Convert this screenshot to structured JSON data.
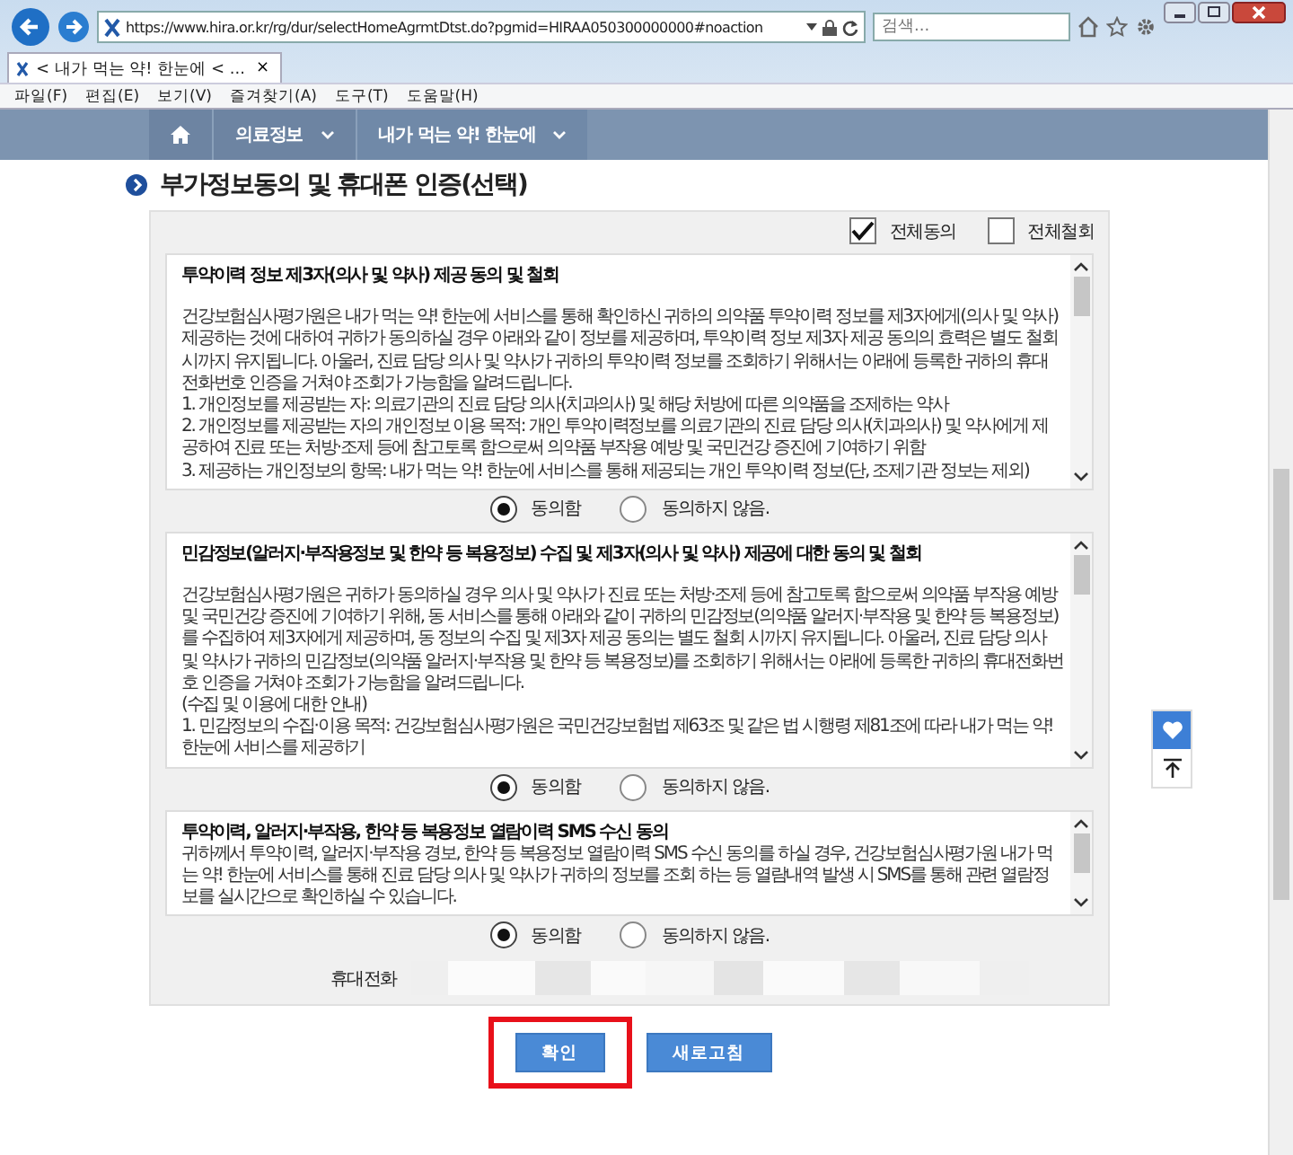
{
  "browser": {
    "url": "https://www.hira.or.kr/rg/dur/selectHomeAgrmtDtst.do?pgmid=HIRAA050300000000#noaction",
    "search_placeholder": "검색...",
    "tab": {
      "title": "< 내가 먹는 약! 한눈에 < ...",
      "close": "×"
    },
    "menu": [
      "파일(F)",
      "편집(E)",
      "보기(V)",
      "즐겨찾기(A)",
      "도구(T)",
      "도움말(H)"
    ]
  },
  "nav": {
    "items": [
      "의료정보",
      "내가 먹는 약! 한눈에"
    ]
  },
  "heading": "부가정보동의 및 휴대폰 인증(선택)",
  "bulk": [
    {
      "label": "전체동의",
      "checked": true
    },
    {
      "label": "전체철회",
      "checked": false
    }
  ],
  "sections": [
    {
      "title": "투약이력 정보 제3자(의사 및 약사) 제공 동의 및 철회",
      "gap": true,
      "paragraphs": [
        "건강보험심사평가원은 내가 먹는 약! 한눈에 서비스를 통해 확인하신 귀하의 의약품 투약이력 정보를 제3자에게(의사 및 약사) 제공하는 것에 대하여 귀하가 동의하실 경우 아래와 같이 정보를 제공하며, 투약이력 정보 제3자 제공 동의의 효력은 별도 철회 시까지 유지됩니다. 아울러, 진료 담당 의사 및 약사가 귀하의 투약이력 정보를 조회하기 위해서는 아래에 등록한 귀하의 휴대전화번호 인증을 거쳐야 조회가 가능함을 알려드립니다.",
        "1. 개인정보를 제공받는 자: 의료기관의 진료 담당 의사(치과의사) 및 해당 처방에 따른 의약품을 조제하는 약사",
        "2. 개인정보를 제공받는 자의 개인정보 이용 목적: 개인 투약이력정보를 의료기관의 진료 담당 의사(치과의사) 및 약사에게 제공하여 진료 또는 처방·조제 등에 참고토록 함으로써 의약품 부작용 예방 및 국민건강 증진에 기여하기 위함",
        "3. 제공하는 개인정보의 항목: 내가 먹는 약! 한눈에 서비스를 통해 제공되는 개인 투약이력 정보(단, 조제기관 정보는 제외)"
      ],
      "options": [
        {
          "label": "동의함",
          "selected": true
        },
        {
          "label": "동의하지 않음.",
          "selected": false
        }
      ]
    },
    {
      "title": "민감정보(알러지·부작용정보 및 한약 등 복용정보) 수집 및 제3자(의사 및 약사) 제공에 대한 동의 및 철회",
      "gap": true,
      "paragraphs": [
        "건강보험심사평가원은 귀하가 동의하실 경우 의사 및 약사가 진료 또는 처방·조제 등에 참고토록 함으로써 의약품 부작용 예방 및 국민건강 증진에 기여하기 위해, 동 서비스를 통해 아래와 같이 귀하의 민감정보(의약품 알러지·부작용 및 한약 등 복용정보)를 수집하여 제3자에게 제공하며, 동 정보의 수집 및 제3자 제공 동의는 별도 철회 시까지 유지됩니다. 아울러, 진료 담당 의사 및 약사가 귀하의 민감정보(의약품 알러지·부작용 및 한약 등 복용정보)를 조회하기 위해서는 아래에 등록한 귀하의 휴대전화번호 인증을 거쳐야 조회가 가능함을 알려드립니다.",
        "(수집 및 이용에 대한 안내)",
        "1. 민감정보의 수집·이용 목적: 건강보험심사평가원은 국민건강보험법 제63조 및 같은 법 시행령 제81조에 따라 내가 먹는 약! 한눈에 서비스를 제공하기"
      ],
      "options": [
        {
          "label": "동의함",
          "selected": true
        },
        {
          "label": "동의하지 않음.",
          "selected": false
        }
      ]
    },
    {
      "title": "투약이력, 알러지·부작용, 한약 등 복용정보 열람이력 SMS 수신 동의",
      "gap": false,
      "paragraphs": [
        "귀하께서 투약이력, 알러지·부작용 경보, 한약 등 복용정보 열람이력 SMS 수신 동의를 하실 경우, 건강보험심사평가원 내가 먹는 약! 한눈에 서비스를 통해 진료 담당 의사 및 약사가 귀하의 정보를 조회 하는 등 열람내역 발생 시 SMS를 통해 관련 열람정보를 실시간으로 확인하실 수 있습니다."
      ],
      "options": [
        {
          "label": "동의함",
          "selected": true
        },
        {
          "label": "동의하지 않음.",
          "selected": false
        }
      ]
    }
  ],
  "phone": {
    "label": "휴대전화"
  },
  "buttons": [
    {
      "label": "확인",
      "highlighted": true
    },
    {
      "label": "새로고침",
      "highlighted": false
    }
  ]
}
